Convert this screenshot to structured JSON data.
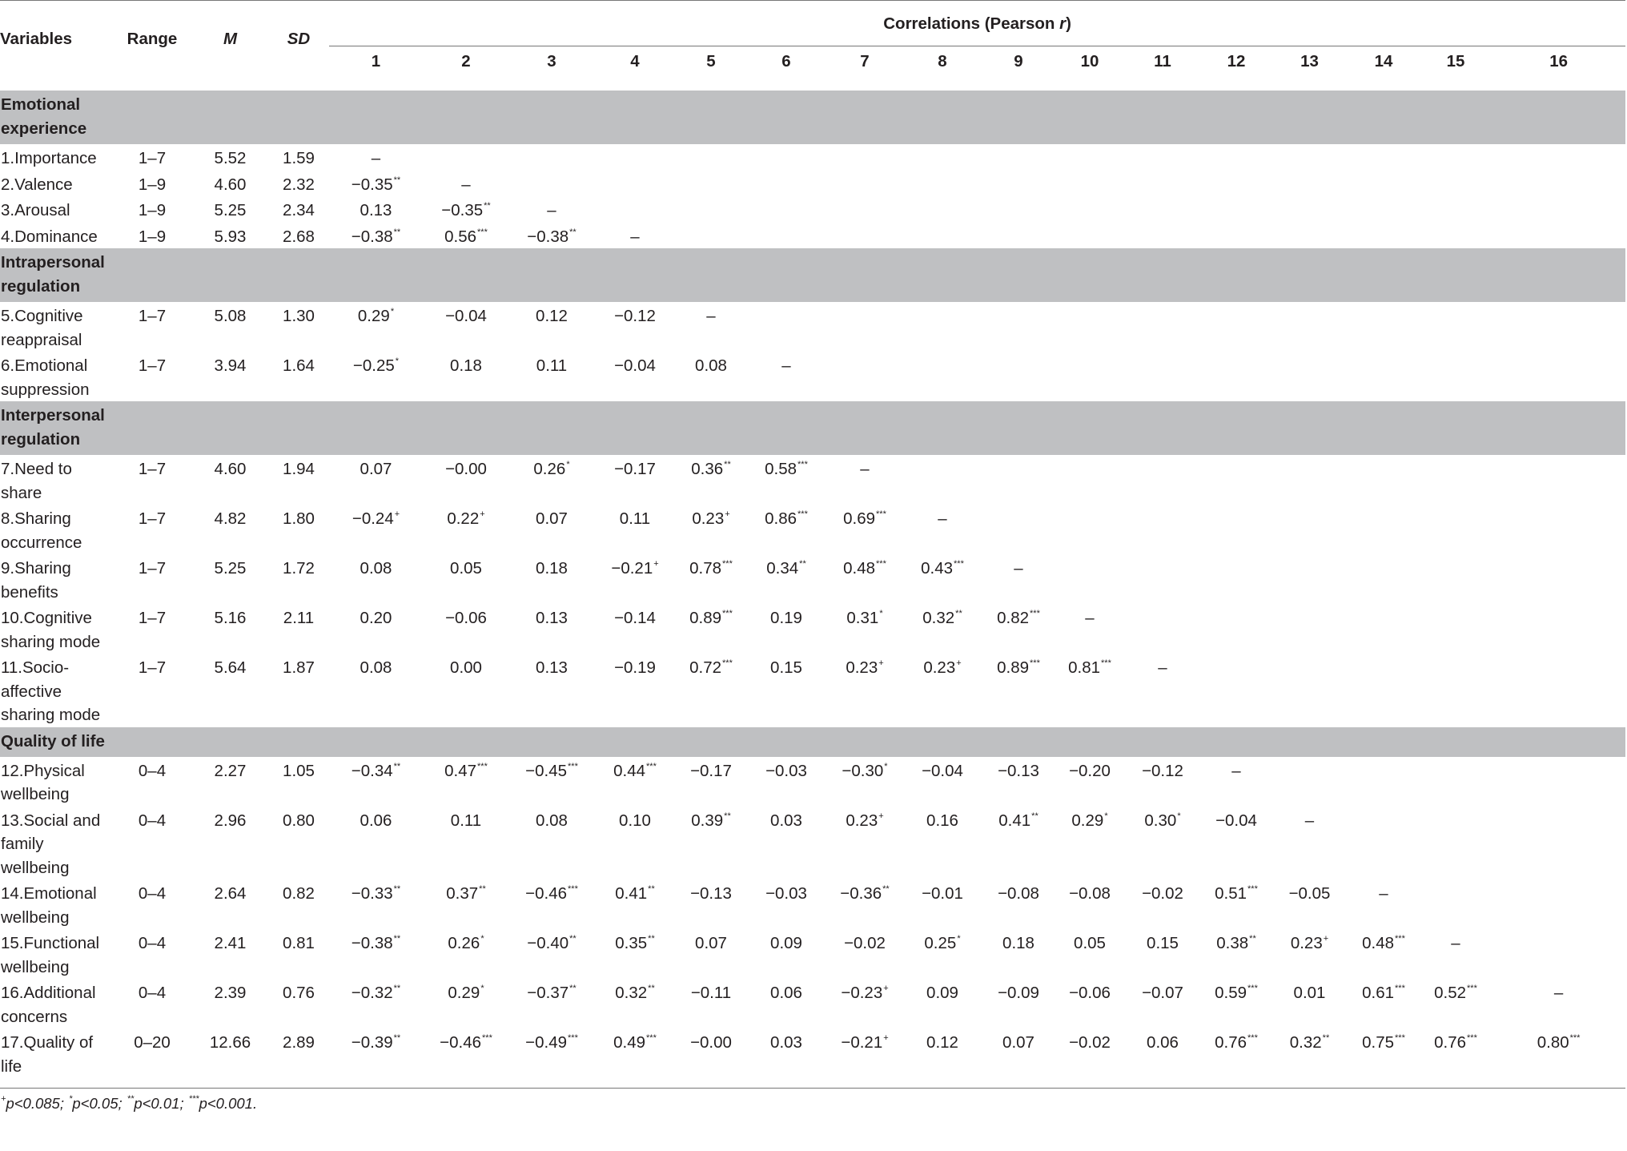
{
  "header": {
    "variables": "Variables",
    "range": "Range",
    "mean": "M",
    "sd": "SD",
    "correlations_prefix": "Correlations (Pearson ",
    "correlations_r": "r",
    "correlations_suffix": ")",
    "col_numbers": [
      "1",
      "2",
      "3",
      "4",
      "5",
      "6",
      "7",
      "8",
      "9",
      "10",
      "11",
      "12",
      "13",
      "14",
      "15",
      "16"
    ]
  },
  "sections": [
    {
      "label": "Emotional experience",
      "rows": [
        {
          "name": "1.Importance",
          "range": "1–7",
          "m": "5.52",
          "sd": "1.59",
          "corr": [
            "–"
          ]
        },
        {
          "name": "2.Valence",
          "range": "1–9",
          "m": "4.60",
          "sd": "2.32",
          "corr": [
            "−0.35**",
            "–"
          ]
        },
        {
          "name": "3.Arousal",
          "range": "1–9",
          "m": "5.25",
          "sd": "2.34",
          "corr": [
            "0.13",
            "−0.35**",
            "–"
          ]
        },
        {
          "name": "4.Dominance",
          "range": "1–9",
          "m": "5.93",
          "sd": "2.68",
          "corr": [
            "−0.38**",
            "0.56***",
            "−0.38**",
            "–"
          ]
        }
      ]
    },
    {
      "label": "Intrapersonal regulation",
      "rows": [
        {
          "name": "5.Cognitive reappraisal",
          "range": "1–7",
          "m": "5.08",
          "sd": "1.30",
          "corr": [
            "0.29*",
            "−0.04",
            "0.12",
            "−0.12",
            "–"
          ]
        },
        {
          "name": "6.Emotional suppression",
          "range": "1–7",
          "m": "3.94",
          "sd": "1.64",
          "corr": [
            "−0.25*",
            "0.18",
            "0.11",
            "−0.04",
            "0.08",
            "–"
          ]
        }
      ]
    },
    {
      "label": "Interpersonal regulation",
      "rows": [
        {
          "name": "7.Need to share",
          "range": "1–7",
          "m": "4.60",
          "sd": "1.94",
          "corr": [
            "0.07",
            "−0.00",
            "0.26*",
            "−0.17",
            "0.36**",
            "0.58***",
            "–"
          ]
        },
        {
          "name": "8.Sharing occurrence",
          "range": "1–7",
          "m": "4.82",
          "sd": "1.80",
          "corr": [
            "−0.24+",
            "0.22+",
            "0.07",
            "0.11",
            "0.23+",
            "0.86***",
            "0.69***",
            "–"
          ]
        },
        {
          "name": "9.Sharing benefits",
          "range": "1–7",
          "m": "5.25",
          "sd": "1.72",
          "corr": [
            "0.08",
            "0.05",
            "0.18",
            "−0.21+",
            "0.78***",
            "0.34**",
            "0.48***",
            "0.43***",
            "–"
          ]
        },
        {
          "name": "10.Cognitive sharing mode",
          "range": "1–7",
          "m": "5.16",
          "sd": "2.11",
          "corr": [
            "0.20",
            "−0.06",
            "0.13",
            "−0.14",
            "0.89***",
            "0.19",
            "0.31*",
            "0.32**",
            "0.82***",
            "–"
          ]
        },
        {
          "name": "11.Socio-affective sharing mode",
          "range": "1–7",
          "m": "5.64",
          "sd": "1.87",
          "corr": [
            "0.08",
            "0.00",
            "0.13",
            "−0.19",
            "0.72***",
            "0.15",
            "0.23+",
            "0.23+",
            "0.89***",
            "0.81***",
            "–"
          ]
        }
      ]
    },
    {
      "label": "Quality of life",
      "rows": [
        {
          "name": "12.Physical wellbeing",
          "range": "0–4",
          "m": "2.27",
          "sd": "1.05",
          "corr": [
            "−0.34**",
            "0.47***",
            "−0.45***",
            "0.44***",
            "−0.17",
            "−0.03",
            "−0.30*",
            "−0.04",
            "−0.13",
            "−0.20",
            "−0.12",
            "–"
          ]
        },
        {
          "name": "13.Social and family wellbeing",
          "range": "0–4",
          "m": "2.96",
          "sd": "0.80",
          "corr": [
            "0.06",
            "0.11",
            "0.08",
            "0.10",
            "0.39**",
            "0.03",
            "0.23+",
            "0.16",
            "0.41**",
            "0.29*",
            "0.30*",
            "−0.04",
            "–"
          ]
        },
        {
          "name": "14.Emotional wellbeing",
          "range": "0–4",
          "m": "2.64",
          "sd": "0.82",
          "corr": [
            "−0.33**",
            "0.37**",
            "−0.46***",
            "0.41**",
            "−0.13",
            "−0.03",
            "−0.36**",
            "−0.01",
            "−0.08",
            "−0.08",
            "−0.02",
            "0.51***",
            "−0.05",
            "–"
          ]
        },
        {
          "name": "15.Functional wellbeing",
          "range": "0–4",
          "m": "2.41",
          "sd": "0.81",
          "corr": [
            "−0.38**",
            "0.26*",
            "−0.40**",
            "0.35**",
            "0.07",
            "0.09",
            "−0.02",
            "0.25*",
            "0.18",
            "0.05",
            "0.15",
            "0.38**",
            "0.23+",
            "0.48***",
            "–"
          ]
        },
        {
          "name": "16.Additional concerns",
          "range": "0–4",
          "m": "2.39",
          "sd": "0.76",
          "corr": [
            "−0.32**",
            "0.29*",
            "−0.37**",
            "0.32**",
            "−0.11",
            "0.06",
            "−0.23+",
            "0.09",
            "−0.09",
            "−0.06",
            "−0.07",
            "0.59***",
            "0.01",
            "0.61***",
            "0.52***",
            "–"
          ]
        },
        {
          "name": "17.Quality of life",
          "range": "0–20",
          "m": "12.66",
          "sd": "2.89",
          "corr": [
            "−0.39**",
            "−0.46***",
            "−0.49***",
            "0.49***",
            "−0.00",
            "0.03",
            "−0.21+",
            "0.12",
            "0.07",
            "−0.02",
            "0.06",
            "0.76***",
            "0.32**",
            "0.75***",
            "0.76***",
            "0.80***"
          ]
        }
      ]
    }
  ],
  "footnote": "+p<0.085; *p<0.05; **p<0.01; ***p<0.001."
}
